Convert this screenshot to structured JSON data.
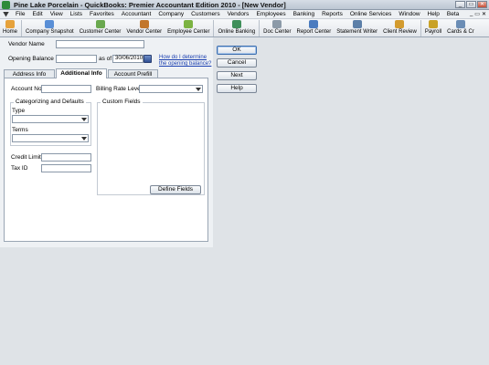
{
  "window": {
    "title": "Pine Lake Porcelain  - QuickBooks: Premier Accountant Edition 2010 - [New Vendor]",
    "controls": {
      "minimize": "_",
      "restore": "▭",
      "close": "✕"
    }
  },
  "menu": {
    "items": [
      "File",
      "Edit",
      "View",
      "Lists",
      "Favorites",
      "Accountant",
      "Company",
      "Customers",
      "Vendors",
      "Employees",
      "Banking",
      "Reports",
      "Online Services",
      "Window",
      "Help",
      "Beta"
    ],
    "mdi_controls": [
      "_",
      "▭",
      "✕"
    ]
  },
  "toolbar": {
    "items": [
      {
        "label": "Home",
        "icon": "home-icon",
        "color": "#e6a23c"
      },
      {
        "label": "Company Snapshot",
        "icon": "company-snapshot-icon",
        "color": "#5a8fd6"
      },
      {
        "label": "Customer Center",
        "icon": "customer-center-icon",
        "color": "#6aa84f"
      },
      {
        "label": "Vendor Center",
        "icon": "vendor-center-icon",
        "color": "#c2762b"
      },
      {
        "label": "Employee Center",
        "icon": "employee-center-icon",
        "color": "#7cb342"
      },
      {
        "label": "Online Banking",
        "icon": "online-banking-icon",
        "color": "#3f8f5a"
      },
      {
        "label": "Doc Center",
        "icon": "doc-center-icon",
        "color": "#8c9aa8"
      },
      {
        "label": "Report Center",
        "icon": "report-center-icon",
        "color": "#4a7bbf"
      },
      {
        "label": "Statement Writer",
        "icon": "statement-writer-icon",
        "color": "#5c7fa8"
      },
      {
        "label": "Client Review",
        "icon": "client-review-icon",
        "color": "#d39b2e"
      },
      {
        "label": "Payroll",
        "icon": "payroll-icon",
        "color": "#c9a227"
      },
      {
        "label": "Cards & Cr",
        "icon": "cards-icon",
        "color": "#6b8db5"
      }
    ]
  },
  "form": {
    "vendor_name_label": "Vendor Name",
    "vendor_name_value": "",
    "opening_balance_label": "Opening Balance",
    "opening_balance_value": "",
    "as_of_label": "as of",
    "as_of_date": "30/06/2010",
    "help_link_line1": "How do I determine",
    "help_link_line2": "the opening balance?"
  },
  "tabs": [
    {
      "label": "Address Info",
      "active": false
    },
    {
      "label": "Additional Info",
      "active": true
    },
    {
      "label": "Account Prefill",
      "active": false
    }
  ],
  "panel": {
    "account_no_label": "Account No.",
    "account_no_value": "",
    "billing_rate_label": "Billing Rate Level",
    "billing_rate_value": "",
    "categorizing_title": "Categorizing and Defaults",
    "type_label": "Type",
    "type_value": "",
    "terms_label": "Terms",
    "terms_value": "",
    "credit_limit_label": "Credit Limit",
    "credit_limit_value": "",
    "tax_id_label": "Tax ID",
    "tax_id_value": "",
    "custom_fields_title": "Custom Fields",
    "define_fields_label": "Define Fields"
  },
  "buttons": {
    "ok": "OK",
    "cancel": "Cancel",
    "next": "Next",
    "help": "Help"
  },
  "colors": {
    "accent": "#3d6fb0",
    "link": "#1a3fb0"
  }
}
